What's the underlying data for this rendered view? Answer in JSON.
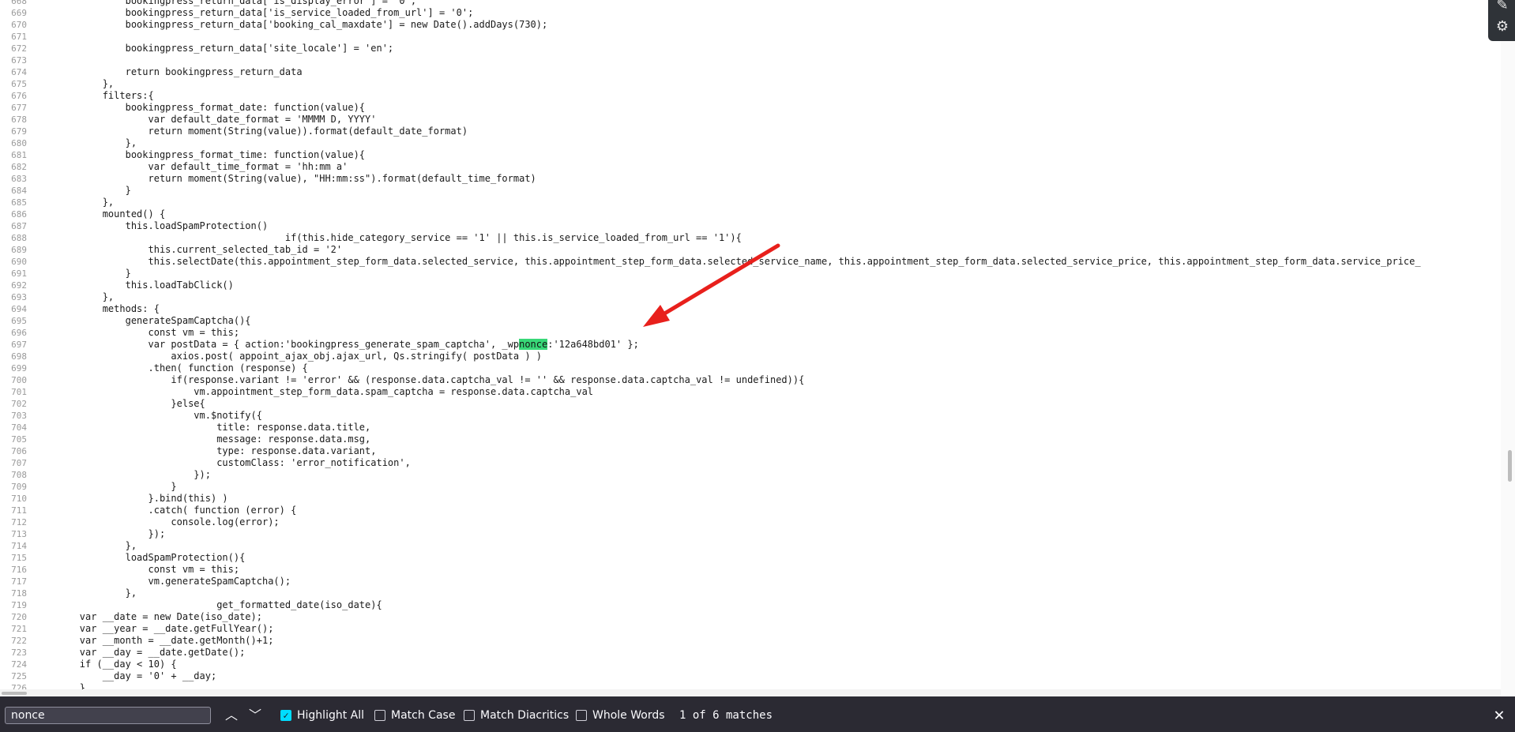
{
  "code": {
    "lines": [
      {
        "n": "668",
        "t": "                bookingpress_return_data['is_display_error'] = '0';"
      },
      {
        "n": "669",
        "t": "                bookingpress_return_data['is_service_loaded_from_url'] = '0';"
      },
      {
        "n": "670",
        "t": "                bookingpress_return_data['booking_cal_maxdate'] = new Date().addDays(730);"
      },
      {
        "n": "671",
        "t": ""
      },
      {
        "n": "672",
        "t": "                bookingpress_return_data['site_locale'] = 'en';"
      },
      {
        "n": "673",
        "t": ""
      },
      {
        "n": "674",
        "t": "                return bookingpress_return_data"
      },
      {
        "n": "675",
        "t": "            },"
      },
      {
        "n": "676",
        "t": "            filters:{"
      },
      {
        "n": "677",
        "t": "                bookingpress_format_date: function(value){"
      },
      {
        "n": "678",
        "t": "                    var default_date_format = 'MMMM D, YYYY'"
      },
      {
        "n": "679",
        "t": "                    return moment(String(value)).format(default_date_format)"
      },
      {
        "n": "680",
        "t": "                },"
      },
      {
        "n": "681",
        "t": "                bookingpress_format_time: function(value){"
      },
      {
        "n": "682",
        "t": "                    var default_time_format = 'hh:mm a'"
      },
      {
        "n": "683",
        "t": "                    return moment(String(value), \"HH:mm:ss\").format(default_time_format)"
      },
      {
        "n": "684",
        "t": "                }"
      },
      {
        "n": "685",
        "t": "            },"
      },
      {
        "n": "686",
        "t": "            mounted() {"
      },
      {
        "n": "687",
        "t": "                this.loadSpamProtection()"
      },
      {
        "n": "688",
        "t": "                                            if(this.hide_category_service == '1' || this.is_service_loaded_from_url == '1'){"
      },
      {
        "n": "689",
        "t": "                    this.current_selected_tab_id = '2'"
      },
      {
        "n": "690",
        "t": "                    this.selectDate(this.appointment_step_form_data.selected_service, this.appointment_step_form_data.selected_service_name, this.appointment_step_form_data.selected_service_price, this.appointment_step_form_data.service_price_"
      },
      {
        "n": "691",
        "t": "                }"
      },
      {
        "n": "692",
        "t": "                this.loadTabClick()"
      },
      {
        "n": "693",
        "t": "            },"
      },
      {
        "n": "694",
        "t": "            methods: {"
      },
      {
        "n": "695",
        "t": "                generateSpamCaptcha(){"
      },
      {
        "n": "696",
        "t": "                    const vm = this;"
      },
      {
        "n": "697",
        "t": "                    var postData = { action:'bookingpress_generate_spam_captcha', _wpnonce:'12a648bd01' };"
      },
      {
        "n": "698",
        "t": "                        axios.post( appoint_ajax_obj.ajax_url, Qs.stringify( postData ) )"
      },
      {
        "n": "699",
        "t": "                    .then( function (response) {"
      },
      {
        "n": "700",
        "t": "                        if(response.variant != 'error' && (response.data.captcha_val != '' && response.data.captcha_val != undefined)){"
      },
      {
        "n": "701",
        "t": "                            vm.appointment_step_form_data.spam_captcha = response.data.captcha_val"
      },
      {
        "n": "702",
        "t": "                        }else{"
      },
      {
        "n": "703",
        "t": "                            vm.$notify({"
      },
      {
        "n": "704",
        "t": "                                title: response.data.title,"
      },
      {
        "n": "705",
        "t": "                                message: response.data.msg,"
      },
      {
        "n": "706",
        "t": "                                type: response.data.variant,"
      },
      {
        "n": "707",
        "t": "                                customClass: 'error_notification',"
      },
      {
        "n": "708",
        "t": "                            });"
      },
      {
        "n": "709",
        "t": "                        }"
      },
      {
        "n": "710",
        "t": "                    }.bind(this) )"
      },
      {
        "n": "711",
        "t": "                    .catch( function (error) {"
      },
      {
        "n": "712",
        "t": "                        console.log(error);"
      },
      {
        "n": "713",
        "t": "                    });"
      },
      {
        "n": "714",
        "t": "                },"
      },
      {
        "n": "715",
        "t": "                loadSpamProtection(){"
      },
      {
        "n": "716",
        "t": "                    const vm = this;"
      },
      {
        "n": "717",
        "t": "                    vm.generateSpamCaptcha();"
      },
      {
        "n": "718",
        "t": "                },"
      },
      {
        "n": "719",
        "t": "                                get_formatted_date(iso_date){"
      },
      {
        "n": "720",
        "t": "        var __date = new Date(iso_date);"
      },
      {
        "n": "721",
        "t": "        var __year = __date.getFullYear();"
      },
      {
        "n": "722",
        "t": "        var __month = __date.getMonth()+1;"
      },
      {
        "n": "723",
        "t": "        var __day = __date.getDate();"
      },
      {
        "n": "724",
        "t": "        if (__day < 10) {"
      },
      {
        "n": "725",
        "t": "            __day = '0' + __day;"
      },
      {
        "n": "726",
        "t": "        }"
      }
    ],
    "highlight": {
      "line": "697",
      "term": "nonce"
    }
  },
  "find_bar": {
    "query": "nonce",
    "previous_icon": "chevron-up-icon",
    "next_icon": "chevron-down-icon",
    "options": [
      {
        "id": "highlight-all",
        "label": "Highlight All",
        "checked": true
      },
      {
        "id": "match-case",
        "label": "Match Case",
        "checked": false
      },
      {
        "id": "match-diacritics",
        "label": "Match Diacritics",
        "checked": false
      },
      {
        "id": "whole-words",
        "label": "Whole Words",
        "checked": false
      }
    ],
    "match_status": "1 of 6 matches",
    "close_icon": "close-icon"
  },
  "side_tools": {
    "icons": [
      "edit-icon",
      "gear-icon"
    ]
  },
  "colors": {
    "highlight": "#38d878",
    "annotation_arrow": "#e8201c",
    "findbar_bg": "#2b2a33",
    "checkbox_accent": "#00ddff"
  }
}
